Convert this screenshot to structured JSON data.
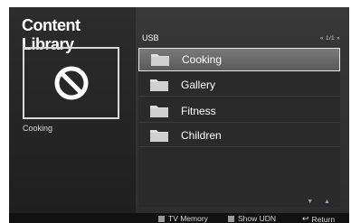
{
  "app": {
    "title": "Content Library"
  },
  "preview": {
    "caption": "Cooking",
    "icon": "no-entry-icon"
  },
  "device": {
    "label": "USB",
    "page_indicator": "« 1/1 »"
  },
  "list": {
    "items": [
      {
        "label": "Cooking",
        "icon": "folder-icon",
        "selected": true
      },
      {
        "label": "Gallery",
        "icon": "folder-icon",
        "selected": false
      },
      {
        "label": "Fitness",
        "icon": "folder-icon",
        "selected": false
      },
      {
        "label": "Children",
        "icon": "folder-icon",
        "selected": false
      }
    ],
    "scroll_arrows": "▼ ▲"
  },
  "footer": {
    "tv_memory": "TV Memory",
    "show_udn": "Show UDN",
    "return": "Return"
  },
  "colors": {
    "background": "#262626",
    "selection": "#6a6a6a",
    "text": "#ffffff",
    "folder": "#d9d9d9"
  }
}
